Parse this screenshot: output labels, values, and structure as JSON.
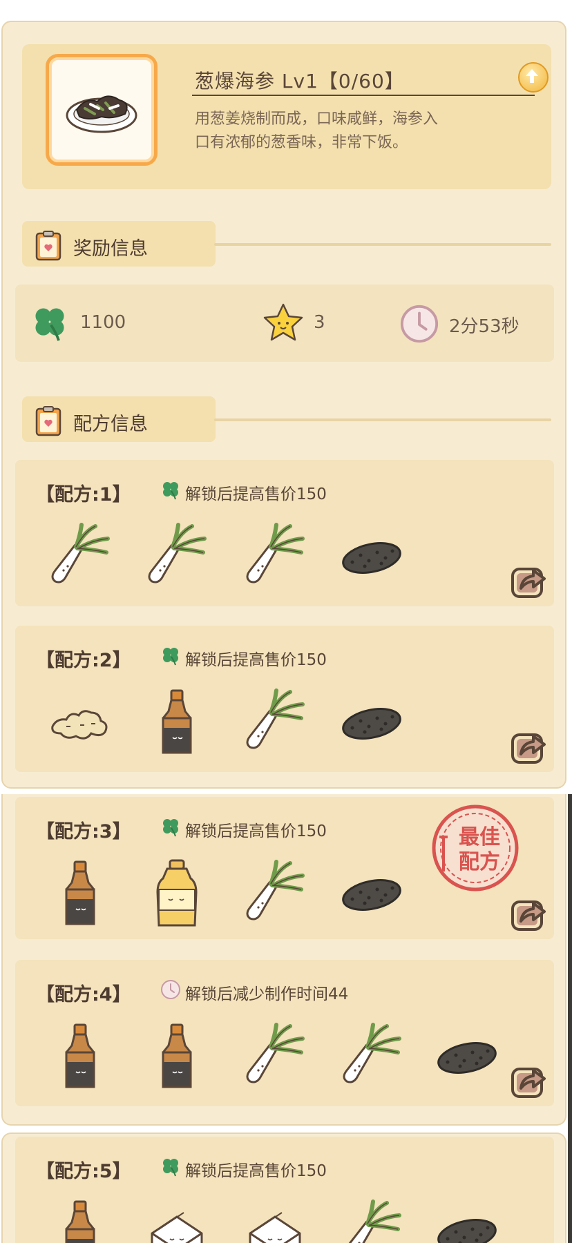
{
  "dish": {
    "title": "葱爆海参 Lv1【0/60】",
    "desc_line1": "用葱姜烧制而成，口味咸鲜，海参入",
    "desc_line2": "口有浓郁的葱香味，非常下饭。",
    "image_icon": "braised-sea-cucumber-dish-icon",
    "upgrade_icon": "upgrade-arrow-icon"
  },
  "reward_section": {
    "label": "奖励信息",
    "icon": "recipe-card-icon"
  },
  "rewards": {
    "clover_value": "1100",
    "star_value": "3",
    "time_value": "2分53秒"
  },
  "recipe_section": {
    "label": "配方信息",
    "icon": "recipe-card-icon"
  },
  "recipes": [
    {
      "title": "【配方:1】",
      "cond_icon": "clover-icon",
      "condition": "解锁后提高售价150",
      "ingredients": [
        "scallion",
        "scallion",
        "scallion",
        "sea-cucumber"
      ]
    },
    {
      "title": "【配方:2】",
      "cond_icon": "clover-icon",
      "condition": "解锁后提高售价150",
      "ingredients": [
        "ginger",
        "soy-sauce",
        "scallion",
        "sea-cucumber"
      ]
    },
    {
      "title": "【配方:3】",
      "cond_icon": "clover-icon",
      "condition": "解锁后提高售价150",
      "ingredients": [
        "soy-sauce",
        "cooking-oil",
        "scallion",
        "sea-cucumber"
      ],
      "stamp": {
        "line1": "最佳",
        "line2": "配方"
      }
    },
    {
      "title": "【配方:4】",
      "cond_icon": "clock-icon",
      "condition": "解锁后减少制作时间44",
      "ingredients": [
        "soy-sauce",
        "soy-sauce",
        "scallion",
        "scallion",
        "sea-cucumber"
      ]
    },
    {
      "title": "【配方:5】",
      "cond_icon": "clover-icon",
      "condition": "解锁后提高售价150",
      "ingredients": [
        "soy-sauce",
        "salt-bag",
        "salt-bag",
        "scallion",
        "sea-cucumber"
      ]
    }
  ],
  "colors": {
    "accent_orange": "#f7a94a",
    "panel_bg": "#f7ecd2",
    "clover_green": "#3f9a5d",
    "stamp_red": "#d9534f"
  }
}
